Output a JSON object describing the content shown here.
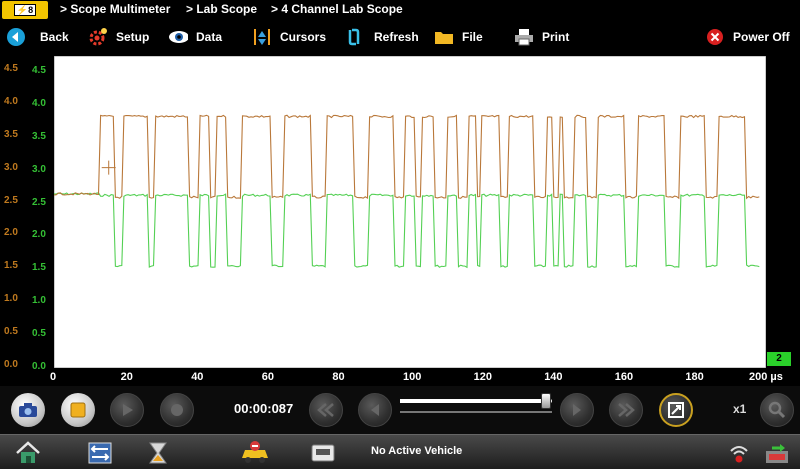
{
  "breadcrumb": [
    "> Scope Multimeter",
    "> Lab Scope",
    "> 4 Channel Lab Scope"
  ],
  "toolbar": {
    "back": "Back",
    "setup": "Setup",
    "data": "Data",
    "cursors": "Cursors",
    "refresh": "Refresh",
    "file": "File",
    "print": "Print",
    "power_off": "Power Off"
  },
  "scope": {
    "y_labels": [
      "4.5",
      "4.0",
      "3.5",
      "3.0",
      "2.5",
      "2.0",
      "1.5",
      "1.0",
      "0.5",
      "0.0"
    ],
    "x_labels": [
      "0",
      "20",
      "40",
      "60",
      "80",
      "100",
      "120",
      "140",
      "160",
      "180"
    ],
    "x_unit_label": "200 µs",
    "x_range_us": [
      0,
      200
    ],
    "y_range": [
      0,
      4.7
    ],
    "channel_badge": "2",
    "colors": {
      "orange": "#b9783a",
      "green": "#54d054",
      "orange_label": "#c07a1f",
      "green_label": "#35c035"
    },
    "trace_high_low": {
      "orange_high": 3.78,
      "orange_low": 2.55,
      "green_high": 2.58,
      "green_low": 1.5,
      "idle": 2.6
    },
    "pulses_us": [
      [
        13,
        17
      ],
      [
        19.5,
        27
      ],
      [
        28.5,
        38
      ],
      [
        41,
        44
      ],
      [
        46,
        49
      ],
      [
        53,
        61.5
      ],
      [
        65,
        73
      ],
      [
        77,
        85
      ],
      [
        89,
        96.5
      ],
      [
        99.5,
        102.5
      ],
      [
        104,
        107.5
      ],
      [
        111,
        114
      ],
      [
        117,
        119.5
      ],
      [
        121,
        126
      ],
      [
        128.5,
        136
      ],
      [
        139.5,
        141
      ],
      [
        143,
        144.5
      ],
      [
        147.5,
        151
      ],
      [
        154,
        161.5
      ],
      [
        165,
        173
      ],
      [
        177,
        184.5
      ],
      [
        188,
        196
      ]
    ]
  },
  "controls": {
    "timer": "00:00:087",
    "zoom": "x1",
    "slider_value": 0.96
  },
  "taskbar": {
    "vehicle": "No Active Vehicle"
  }
}
